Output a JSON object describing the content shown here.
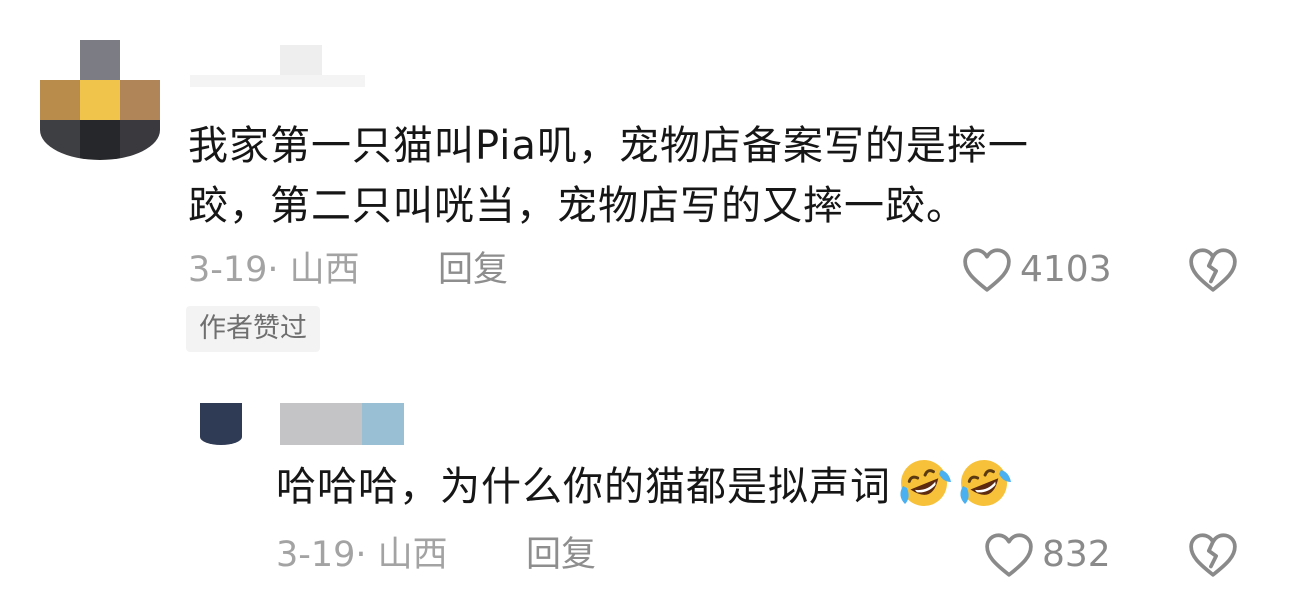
{
  "comments": [
    {
      "text_line1": "我家第一只猫叫Pia叽，宠物店备案写的是摔一",
      "text_line2": "跤，第二只叫咣当，宠物店写的又摔一跤。",
      "date_location": "3-19· 山西",
      "reply_label": "回复",
      "like_count": "4103",
      "badge": "作者赞过",
      "replies": [
        {
          "text": "哈哈哈，为什么你的猫都是拟声词",
          "emojis": [
            "rolling-laughing-emoji",
            "rolling-laughing-emoji"
          ],
          "date_location": "3-19· 山西",
          "reply_label": "回复",
          "like_count": "832"
        }
      ]
    }
  ],
  "icons": {
    "like": "heart-outline-icon",
    "dislike": "broken-heart-icon"
  },
  "colors": {
    "text": "#161616",
    "meta": "#a3a3a3",
    "icon": "#8a8a8a",
    "badge_bg": "#f3f3f3"
  }
}
